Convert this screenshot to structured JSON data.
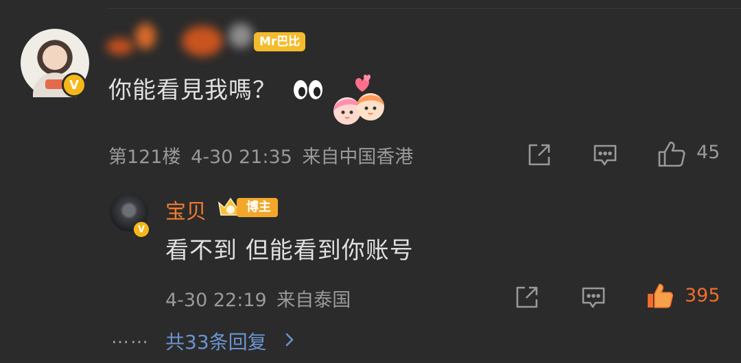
{
  "comment": {
    "badge": "Mr巴比",
    "text": "你能看見我嗎？",
    "eyes": "👀",
    "floor": "第121楼",
    "datetime": "4-30 21:35",
    "source": "来自中国香港",
    "likes": "45",
    "verified_mark": "V"
  },
  "reply": {
    "author": "宝贝",
    "author_tag": "博主",
    "text": "看不到 但能看到你账号",
    "datetime": "4-30 22:19",
    "source": "来自泰国",
    "likes": "395",
    "verified_mark": "V"
  },
  "more": {
    "dots": "……",
    "label": "共33条回复"
  },
  "colors": {
    "background": "#2b2b2b",
    "accent_orange": "#f26d2b",
    "link_blue": "#6b94d1",
    "badge_gold": "#f3bc2d"
  }
}
